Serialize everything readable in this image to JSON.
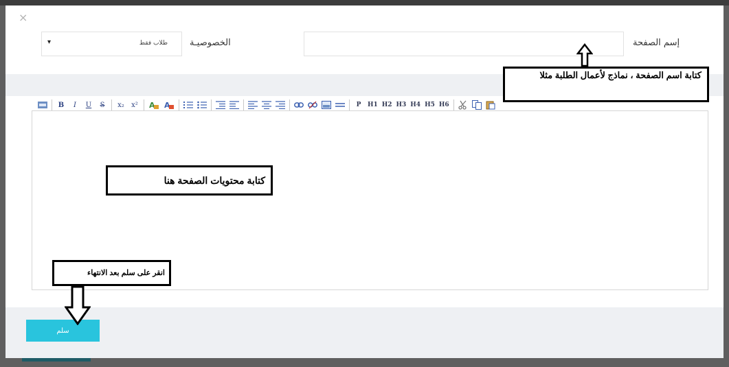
{
  "modal": {
    "close_symbol": "×",
    "page_name_label": "إسم الصفحة",
    "page_name_value": "",
    "privacy_label": "الخصوصيـة",
    "privacy_selected": "طلاب فقط",
    "privacy_caret": "▾",
    "submit_label": "سلم"
  },
  "toolbar": {
    "bold": "B",
    "italic": "I",
    "underline": "U",
    "strike": "S",
    "subscript": "x₂",
    "superscript": "x²",
    "paragraph": "P",
    "h1": "H1",
    "h2": "H2",
    "h3": "H3",
    "h4": "H4",
    "h5": "H5",
    "h6": "H6"
  },
  "annotations": {
    "page_name_hint": "كتابة اسم الصفحة ، نماذج لأعمال الطلبة مثلا",
    "content_hint": "كتابة محتويات الصفحة هنا",
    "submit_hint": "انقر على سلم بعد الانتهاء"
  },
  "colors": {
    "accent": "#29c4dd",
    "band": "#eef0f3",
    "overlay": "#5f5f5f"
  }
}
